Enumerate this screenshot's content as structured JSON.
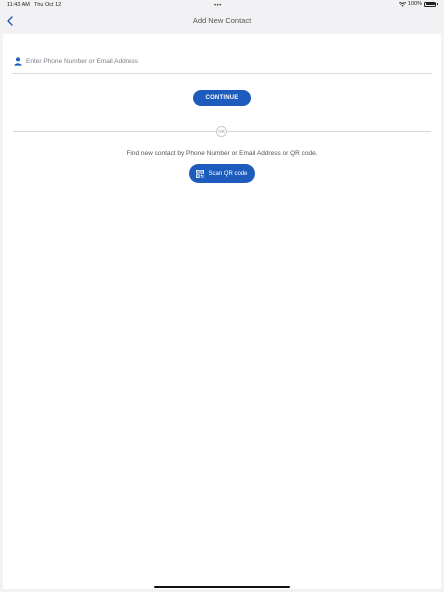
{
  "status_bar": {
    "time": "11:43 AM",
    "date": "Thu Oct 12",
    "battery": "100%",
    "battery_level": 1.0,
    "dots": "•••"
  },
  "nav": {
    "title": "Add New Contact",
    "back_icon": "chevron-left-icon"
  },
  "form": {
    "input_icon": "person-icon",
    "input_placeholder": "Enter Phone Number or Email Address",
    "input_value": "",
    "continue_label": "CONTINUE"
  },
  "divider": {
    "label": "OR"
  },
  "qr": {
    "hint": "Find new contact by Phone Number or Email Address or QR code.",
    "icon": "qr-code-icon",
    "button_label": "Scan QR code"
  },
  "colors": {
    "accent": "#1d5cbc",
    "background": "#f2f2f4",
    "card": "#ffffff"
  }
}
